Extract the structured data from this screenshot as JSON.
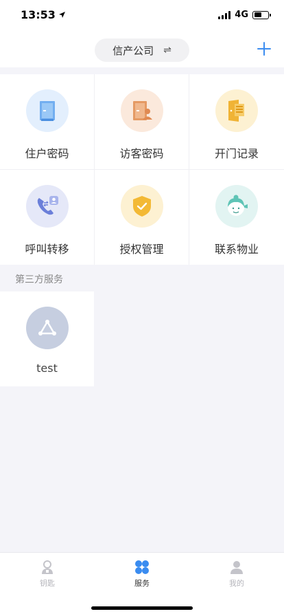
{
  "status": {
    "time": "13:53",
    "network": "4G"
  },
  "header": {
    "company": "信产公司",
    "swap_glyph": "⇌"
  },
  "services": [
    {
      "label": "住户密码",
      "icon": "door-icon"
    },
    {
      "label": "访客密码",
      "icon": "visitor-door-icon"
    },
    {
      "label": "开门记录",
      "icon": "open-record-icon"
    },
    {
      "label": "呼叫转移",
      "icon": "call-forward-icon"
    },
    {
      "label": "授权管理",
      "icon": "shield-check-icon"
    },
    {
      "label": "联系物业",
      "icon": "property-staff-icon"
    }
  ],
  "third_party": {
    "title": "第三方服务",
    "items": [
      {
        "label": "test",
        "icon": "share-triangle-icon"
      }
    ]
  },
  "tabs": [
    {
      "label": "钥匙",
      "icon": "key-user-icon",
      "active": false
    },
    {
      "label": "服务",
      "icon": "clover-grid-icon",
      "active": true
    },
    {
      "label": "我的",
      "icon": "person-icon",
      "active": false
    }
  ],
  "colors": {
    "accent": "#3a8cf0",
    "door_bg": "#e3effd",
    "visitor_bg": "#fbe9dc",
    "record_bg": "#fdf1d2",
    "call_bg": "#e5e8f8",
    "shield_bg": "#fdf1d2",
    "staff_bg": "#e2f4f2",
    "share_bg": "#c6cee0"
  }
}
